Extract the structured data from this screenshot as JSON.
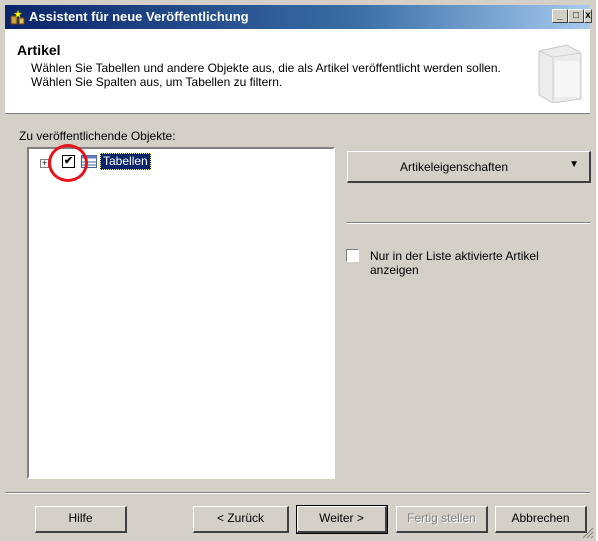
{
  "window": {
    "title": "Assistent für neue Veröffentlichung",
    "controls": {
      "minimize": "_",
      "maximize": "□",
      "close": "x"
    }
  },
  "header": {
    "title": "Artikel",
    "description": "Wählen Sie Tabellen und andere Objekte aus, die als Artikel veröffentlicht werden sollen. Wählen Sie Spalten aus, um Tabellen zu filtern."
  },
  "objects": {
    "label": "Zu veröffentlichende Objekte:",
    "tree": [
      {
        "label": "Tabellen",
        "checked": true,
        "expanded": false,
        "selected": true,
        "icon": "table-icon"
      }
    ]
  },
  "article_properties_button": {
    "label": "Artikeleigenschaften",
    "arrow": "▼"
  },
  "only_checked_option": {
    "label": "Nur in der Liste aktivierte Artikel anzeigen",
    "checked": false
  },
  "buttons": {
    "help": "Hilfe",
    "back": "< Zurück",
    "next": "Weiter >",
    "finish": "Fertig stellen",
    "cancel": "Abbrechen"
  },
  "colors": {
    "dialog_background": "#d4d0c8",
    "title_bar_start": "#0a246a",
    "title_bar_end": "#a6caf0",
    "selection": "#0a246a",
    "highlight_circle": "#e8121d"
  }
}
